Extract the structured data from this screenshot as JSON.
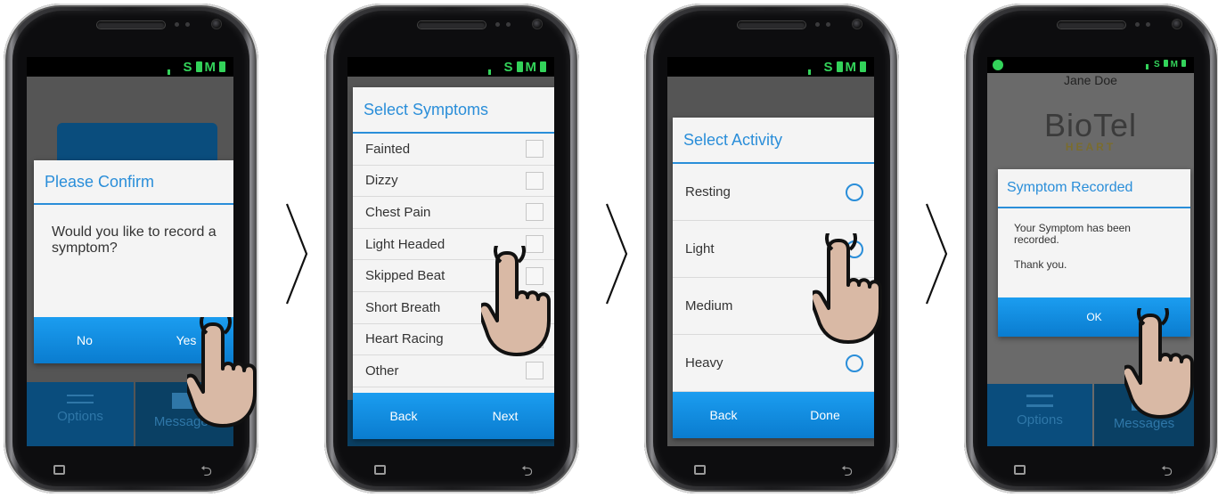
{
  "status": {
    "label": "S M"
  },
  "screen1": {
    "dialog_title": "Please Confirm",
    "message": "Would you like to record a symptom?",
    "no_label": "No",
    "yes_label": "Yes",
    "tile_options": "Options",
    "tile_messages": "Messages"
  },
  "screen2": {
    "dialog_title": "Select Symptoms",
    "items": [
      "Fainted",
      "Dizzy",
      "Chest Pain",
      "Light Headed",
      "Skipped Beat",
      "Short Breath",
      "Heart Racing",
      "Other"
    ],
    "back_label": "Back",
    "next_label": "Next"
  },
  "screen3": {
    "dialog_title": "Select Activity",
    "items": [
      "Resting",
      "Light",
      "Medium",
      "Heavy"
    ],
    "back_label": "Back",
    "done_label": "Done"
  },
  "screen4": {
    "user_name": "Jane Doe",
    "logo_text": "BioTel",
    "logo_sub": "HEART",
    "dialog_title": "Symptom Recorded",
    "message": "Your Symptom has been recorded.",
    "thanks": "Thank you.",
    "ok_label": "OK",
    "tile_options": "Options",
    "tile_messages": "Messages"
  },
  "colors": {
    "accent": "#2a8ed9",
    "button_bar": "#1593e6",
    "status_green": "#33d35a",
    "tile_blue": "#0a4d7d"
  },
  "icons": [
    "chevron-right-icon",
    "pointing-hand-icon",
    "recent-apps-icon",
    "back-key-icon",
    "options-icon",
    "messages-icon",
    "battery-icon",
    "signal-icon"
  ]
}
